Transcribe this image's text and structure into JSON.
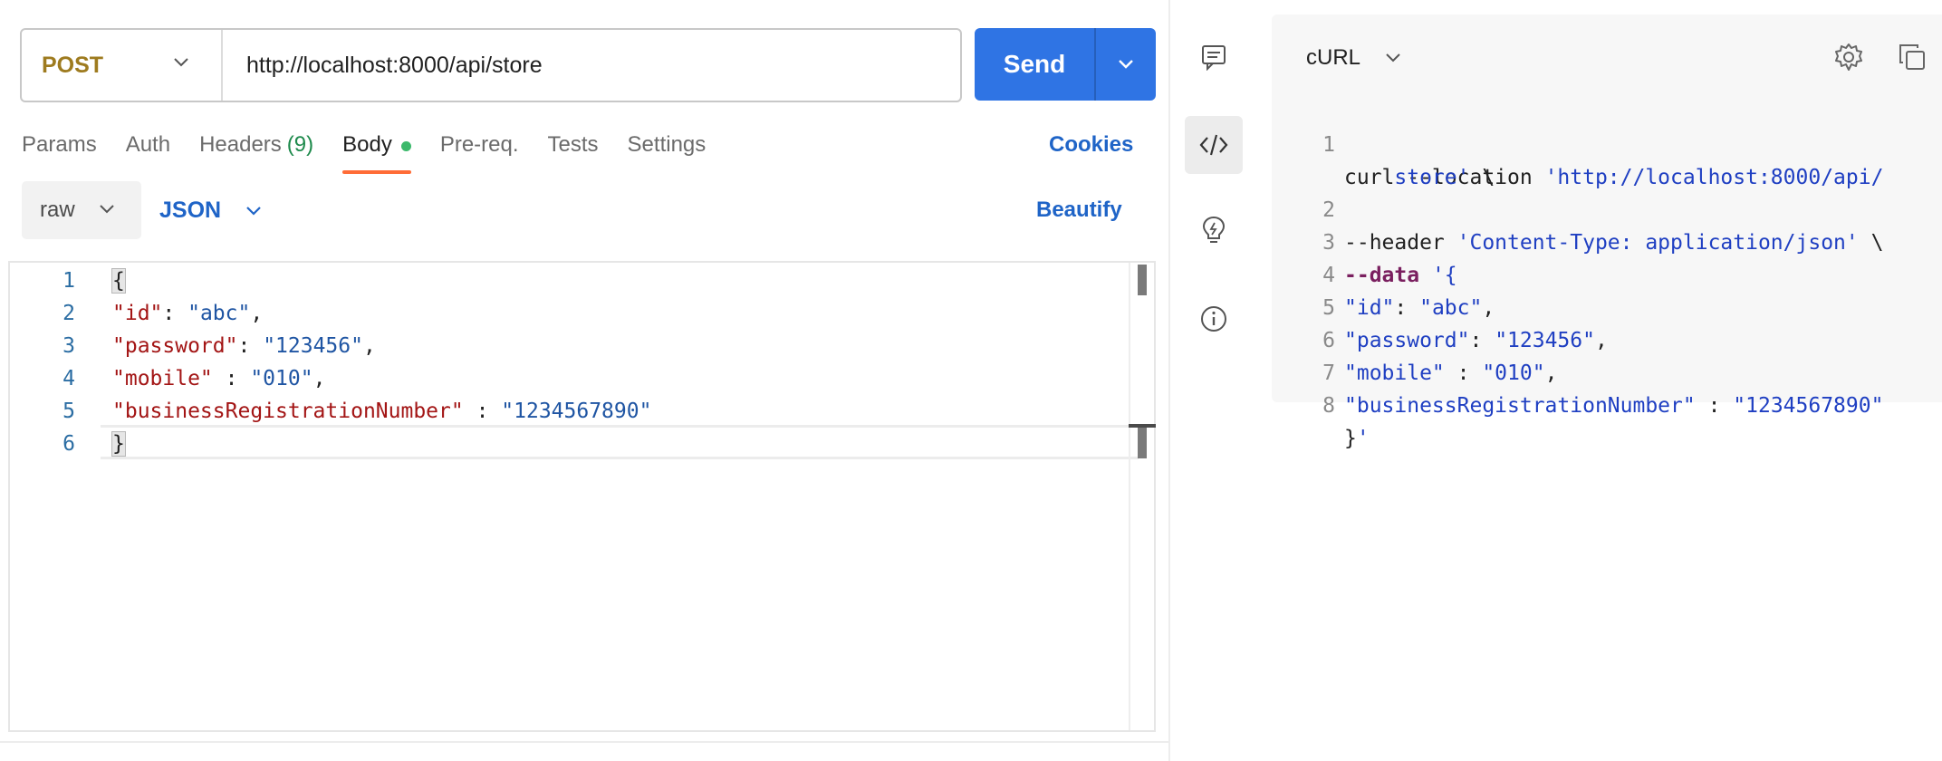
{
  "request": {
    "method": "POST",
    "url": "http://localhost:8000/api/store",
    "send_label": "Send"
  },
  "tabs": [
    {
      "label": "Params"
    },
    {
      "label": "Auth"
    },
    {
      "label": "Headers",
      "count": "(9)"
    },
    {
      "label": "Body",
      "active": true
    },
    {
      "label": "Pre-req."
    },
    {
      "label": "Tests"
    },
    {
      "label": "Settings"
    }
  ],
  "cookies_label": "Cookies",
  "body": {
    "mode": "raw",
    "language": "JSON",
    "beautify_label": "Beautify",
    "lines": [
      {
        "n": "1",
        "key": "",
        "sep": "",
        "value": "",
        "brace": "{"
      },
      {
        "n": "2",
        "key": "\"id\"",
        "sep": ": ",
        "value": "\"abc\"",
        "end": ","
      },
      {
        "n": "3",
        "key": "\"password\"",
        "sep": ": ",
        "value": "\"123456\"",
        "end": ","
      },
      {
        "n": "4",
        "key": "\"mobile\"",
        "sep": " : ",
        "value": "\"010\"",
        "end": ","
      },
      {
        "n": "5",
        "key": "\"businessRegistrationNumber\"",
        "sep": " : ",
        "value": "\"1234567890\"",
        "end": ""
      },
      {
        "n": "6",
        "key": "",
        "sep": "",
        "value": "",
        "brace": "}"
      }
    ]
  },
  "snippet": {
    "language": "cURL",
    "lines": [
      {
        "n": "1",
        "a": "curl --location ",
        "s": "'http://localhost:8000/api/",
        "b": ""
      },
      {
        "n": "",
        "a": "    ",
        "s": "store'",
        "b": " \\"
      },
      {
        "n": "2",
        "a": "--header ",
        "s": "'Content-Type: application/json'",
        "b": " \\"
      },
      {
        "n": "3",
        "kw": "--data",
        "s": " '{",
        "b": ""
      },
      {
        "n": "4",
        "a": "",
        "s": "\"id\"",
        "b": ": ",
        "s2": "\"abc\"",
        "c": ","
      },
      {
        "n": "5",
        "a": "",
        "s": "\"password\"",
        "b": ": ",
        "s2": "\"123456\"",
        "c": ","
      },
      {
        "n": "6",
        "a": "",
        "s": "\"mobile\"",
        "b": " : ",
        "s2": "\"010\"",
        "c": ","
      },
      {
        "n": "7",
        "a": "",
        "s": "\"businessRegistrationNumber\"",
        "b": " : ",
        "s2": "\"1234567890\"",
        "c": ""
      },
      {
        "n": "8",
        "a": "}",
        "s": "'",
        "b": ""
      }
    ]
  },
  "side_icons": [
    "comment-icon",
    "code-icon",
    "lightbulb-icon",
    "info-icon"
  ],
  "colors": {
    "accent": "#2f74e4",
    "active_tab_underline": "#ff6c37",
    "method": "#9e7b1f",
    "link": "#1f64c7"
  }
}
